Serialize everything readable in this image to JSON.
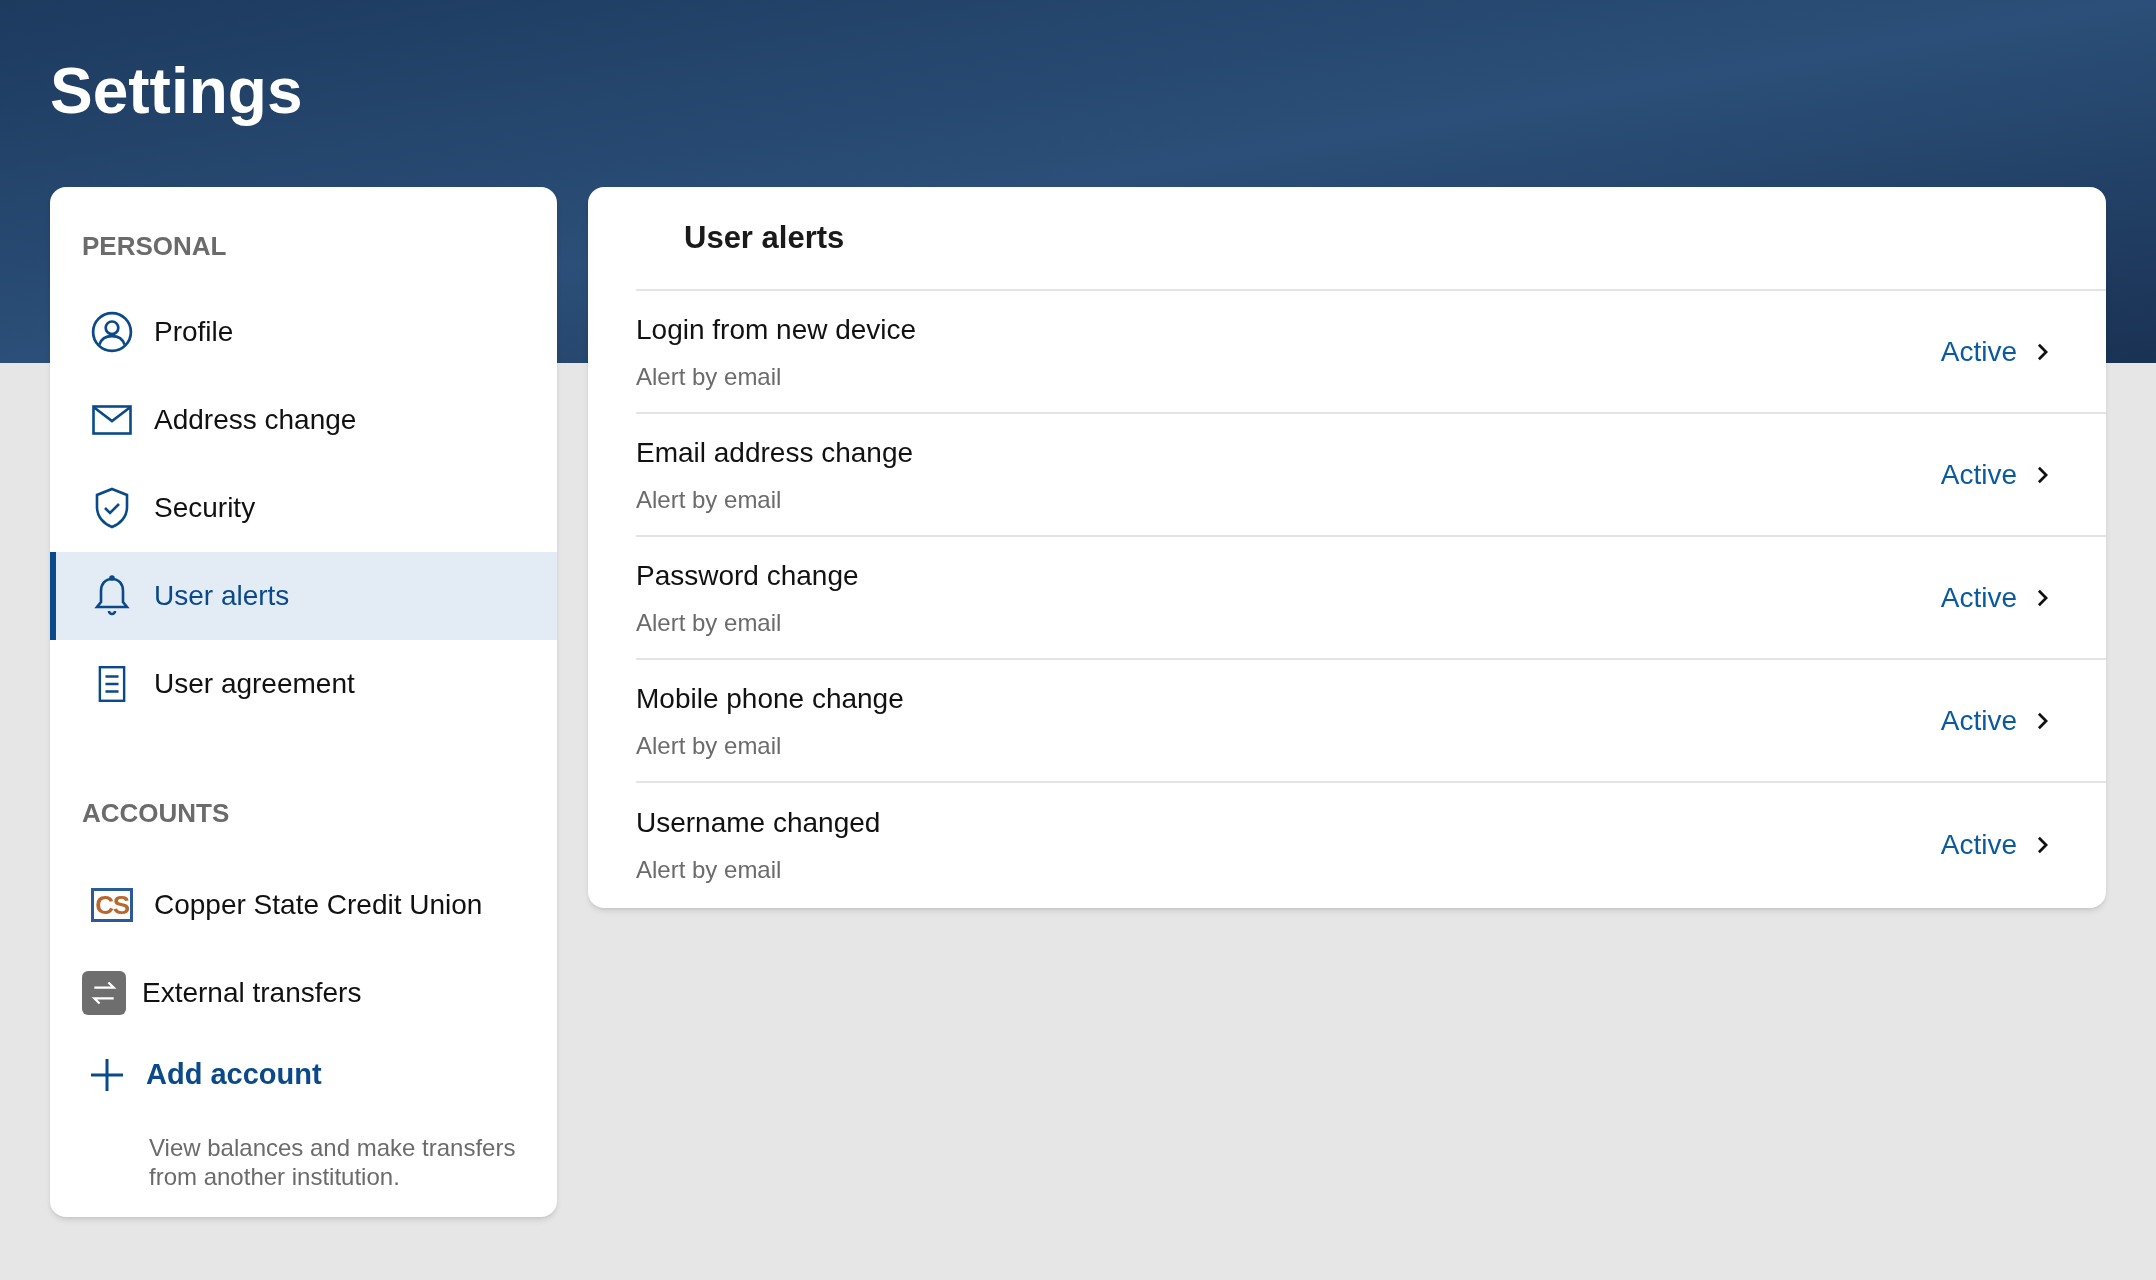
{
  "page_title": "Settings",
  "sidebar": {
    "sections": [
      {
        "heading": "PERSONAL",
        "items": [
          {
            "kind": "profile",
            "label": "Profile",
            "selected": false
          },
          {
            "kind": "mail",
            "label": "Address change",
            "selected": false
          },
          {
            "kind": "shield",
            "label": "Security",
            "selected": false
          },
          {
            "kind": "bell",
            "label": "User alerts",
            "selected": true
          },
          {
            "kind": "document",
            "label": "User agreement",
            "selected": false
          }
        ]
      },
      {
        "heading": "ACCOUNTS",
        "items": [
          {
            "kind": "logo",
            "label": "Copper State Credit Union",
            "logo_text": "CS"
          },
          {
            "kind": "transfer",
            "label": "External transfers"
          }
        ]
      }
    ],
    "add_account": {
      "label": "Add account",
      "description": "View balances and make transfers from another institution."
    }
  },
  "alerts": {
    "title": "User alerts",
    "rows": [
      {
        "title": "Login from new device",
        "subtitle": "Alert by email",
        "status": "Active"
      },
      {
        "title": "Email address change",
        "subtitle": "Alert by email",
        "status": "Active"
      },
      {
        "title": "Password change",
        "subtitle": "Alert by email",
        "status": "Active"
      },
      {
        "title": "Mobile phone change",
        "subtitle": "Alert by email",
        "status": "Active"
      },
      {
        "title": "Username changed",
        "subtitle": "Alert by email",
        "status": "Active"
      }
    ]
  }
}
